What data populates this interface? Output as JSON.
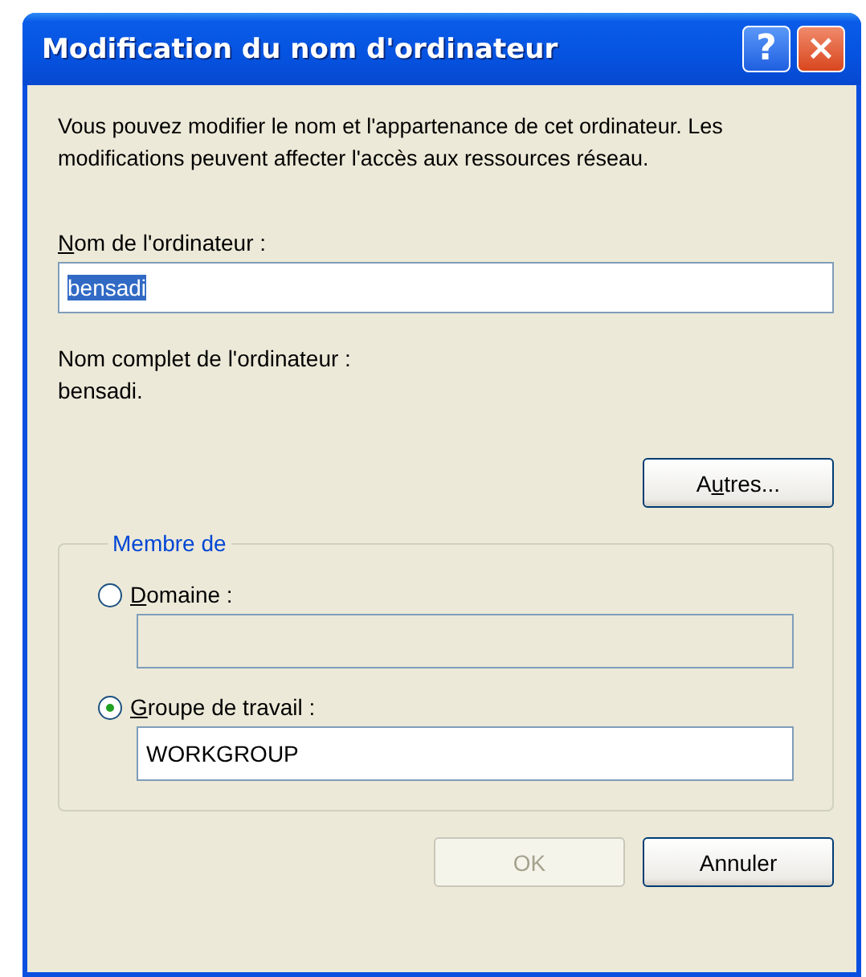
{
  "window": {
    "title": "Modification du nom d'ordinateur",
    "help_button": "?",
    "close_button": "×"
  },
  "intro": "Vous pouvez modifier le nom et l'appartenance de cet ordinateur. Les modifications peuvent affecter l'accès aux ressources réseau.",
  "computer_name": {
    "label": {
      "key": "N",
      "after": "om de l'ordinateur :"
    },
    "value": "bensadi",
    "selected": true
  },
  "full_name": {
    "label": "Nom complet de l'ordinateur :",
    "value": "bensadi."
  },
  "more_button": {
    "before": "A",
    "key": "u",
    "after": "tres..."
  },
  "member_of": {
    "legend": "Membre de",
    "options": [
      {
        "label": {
          "key": "D",
          "after": "omaine :"
        },
        "selected": false,
        "disabled": true
      },
      {
        "label": {
          "key": "G",
          "after": "roupe de travail :"
        },
        "selected": true,
        "value": "WORKGROUP",
        "disabled": false
      }
    ]
  },
  "buttons": [
    {
      "label": "OK",
      "disabled": true
    },
    {
      "label": "Annuler",
      "disabled": false
    }
  ]
}
